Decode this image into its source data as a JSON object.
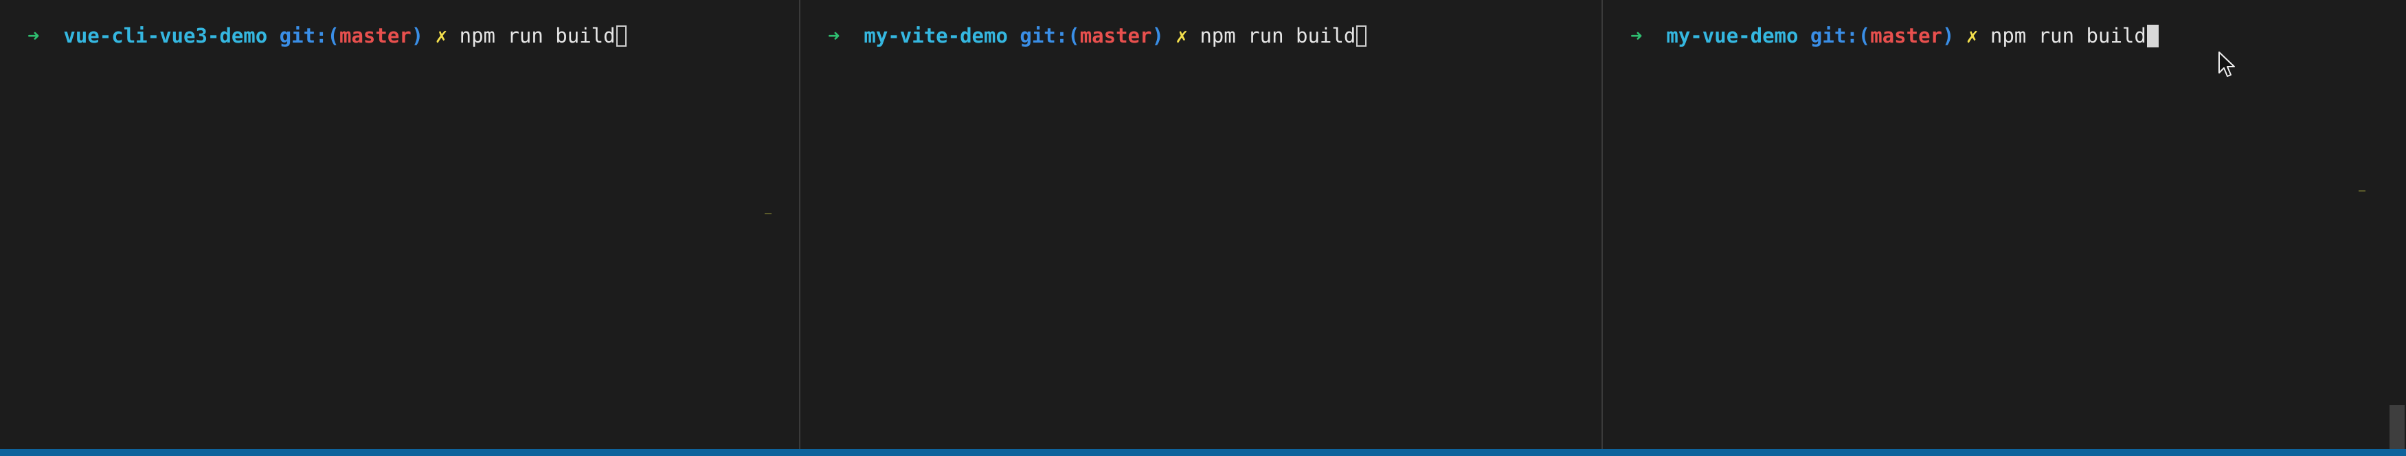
{
  "terminal": {
    "panes": [
      {
        "prompt_symbol": "➜",
        "directory": "vue-cli-vue3-demo",
        "git_prefix": "git:(",
        "branch": "master",
        "git_suffix": ")",
        "dirty_marker": "✗",
        "command": "npm run build"
      },
      {
        "prompt_symbol": "➜",
        "directory": "my-vite-demo",
        "git_prefix": "git:(",
        "branch": "master",
        "git_suffix": ")",
        "dirty_marker": "✗",
        "command": "npm run build"
      },
      {
        "prompt_symbol": "➜",
        "directory": "my-vue-demo",
        "git_prefix": "git:(",
        "branch": "master",
        "git_suffix": ")",
        "dirty_marker": "✗",
        "command": "npm run build"
      }
    ]
  },
  "colors": {
    "background": "#1c1c1c",
    "prompt_arrow": "#2fbf71",
    "directory": "#35b7e0",
    "git_label": "#3a8ee6",
    "branch": "#e8504e",
    "dirty_marker": "#f4e04d",
    "command_text": "#e6e6e6",
    "status_bar": "#0e639c"
  },
  "icons": {
    "mouse": "mouse-pointer-icon"
  }
}
